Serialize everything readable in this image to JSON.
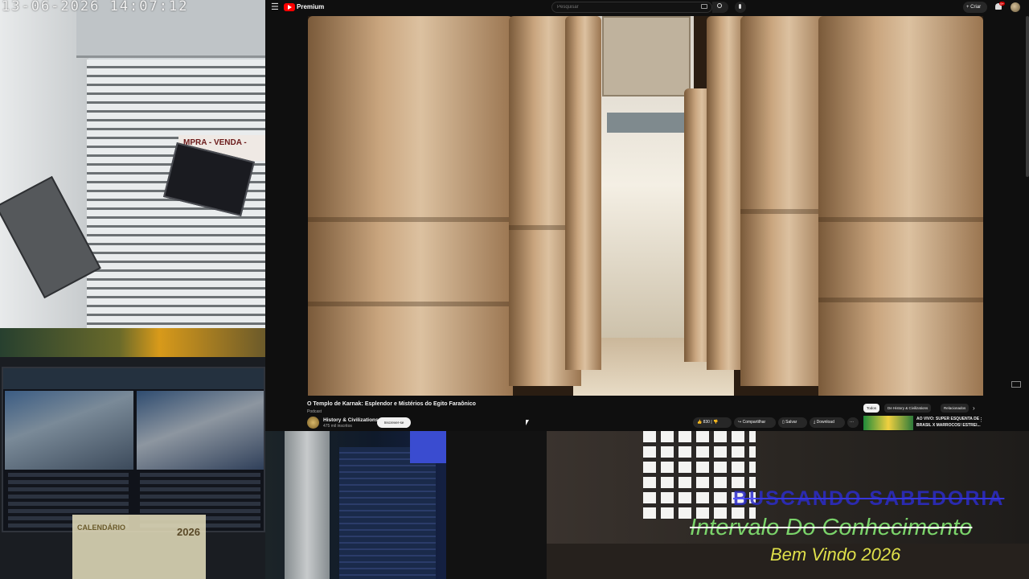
{
  "camera": {
    "timestamp": "13-06-2026  14:07:12",
    "sign_text": "MPRA - VENDA - LOT"
  },
  "desk": {
    "calendar_title": "CALENDÁRIO",
    "calendar_year": "2026"
  },
  "youtube": {
    "brand": "Premium",
    "search_placeholder": "Pesquisar",
    "create_label": "+ Criar",
    "notification_count": "9+",
    "video": {
      "title": "O Templo de Karnak: Esplendor e Mistérios do Egito Faraônico",
      "subtag": "Podcast",
      "channel_name": "History & Civilizations",
      "channel_subs": "475 mil inscritos",
      "subscribe_label": "Inscrever-se",
      "like_count": "830",
      "share_label": "Compartilhar",
      "save_label": "Salvar",
      "download_label": "Download",
      "more_label": "···"
    },
    "chips": {
      "all": "Todos",
      "from": "De History & Civilizations",
      "related": "Relacionados",
      "next_icon": "chevron-right-icon"
    },
    "suggestion": {
      "title_line1": "AO VIVO: SUPER ESQUENTA DE",
      "title_line2": "BRASIL X MARROCOS! ESTREI..."
    }
  },
  "overlay": {
    "line1": "BUSCANDO SABEDORIA",
    "line2": "Intervalo Do Conhecimento",
    "line3": "Bem Vindo 2026"
  },
  "colors": {
    "youtube_red": "#ff0000",
    "overlay_blue": "#2c2cc8",
    "overlay_green": "#7ad36a",
    "overlay_yellow": "#dfe04a"
  }
}
